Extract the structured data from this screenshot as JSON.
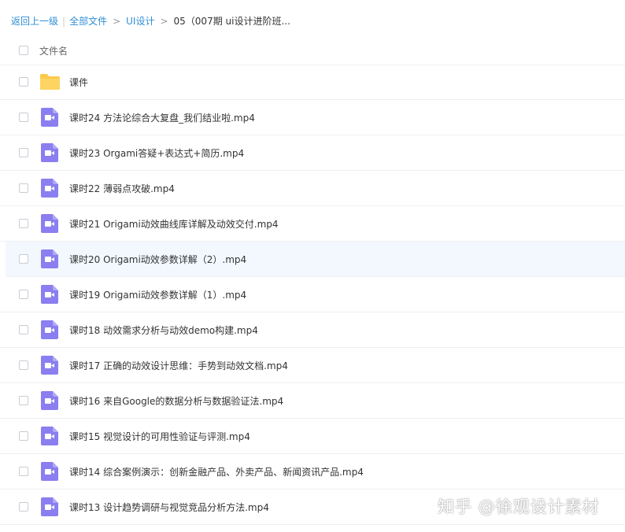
{
  "breadcrumb": {
    "back": "返回上一级",
    "separator": "|",
    "all_files": "全部文件",
    "gt": ">",
    "level1": "UI设计",
    "current": "05（007期 ui设计进阶班..."
  },
  "header": {
    "name_label": "文件名"
  },
  "items": [
    {
      "type": "folder",
      "name": "课件"
    },
    {
      "type": "video",
      "name": "课时24 方法论综合大复盘_我们结业啦.mp4"
    },
    {
      "type": "video",
      "name": "课时23 Orgami答疑+表达式+简历.mp4"
    },
    {
      "type": "video",
      "name": "课时22 薄弱点攻破.mp4"
    },
    {
      "type": "video",
      "name": "课时21 Origami动效曲线库详解及动效交付.mp4"
    },
    {
      "type": "video",
      "name": "课时20 Origami动效参数详解（2）.mp4"
    },
    {
      "type": "video",
      "name": "课时19 Origami动效参数详解（1）.mp4"
    },
    {
      "type": "video",
      "name": "课时18 动效需求分析与动效demo构建.mp4"
    },
    {
      "type": "video",
      "name": "课时17 正确的动效设计思维：手势到动效文档.mp4"
    },
    {
      "type": "video",
      "name": "课时16 来自Google的数据分析与数据验证法.mp4"
    },
    {
      "type": "video",
      "name": "课时15 视觉设计的可用性验证与评测.mp4"
    },
    {
      "type": "video",
      "name": "课时14 综合案例演示：创新金融产品、外卖产品、新闻资讯产品.mp4"
    },
    {
      "type": "video",
      "name": "课时13 设计趋势调研与视觉竞品分析方法.mp4"
    }
  ],
  "watermark": "知乎 @徐观设计素材",
  "colors": {
    "link": "#2e8ed6",
    "folder": "#fcc94b",
    "video_icon": "#8a7ef0",
    "hover_row": "#f2f8fe"
  }
}
